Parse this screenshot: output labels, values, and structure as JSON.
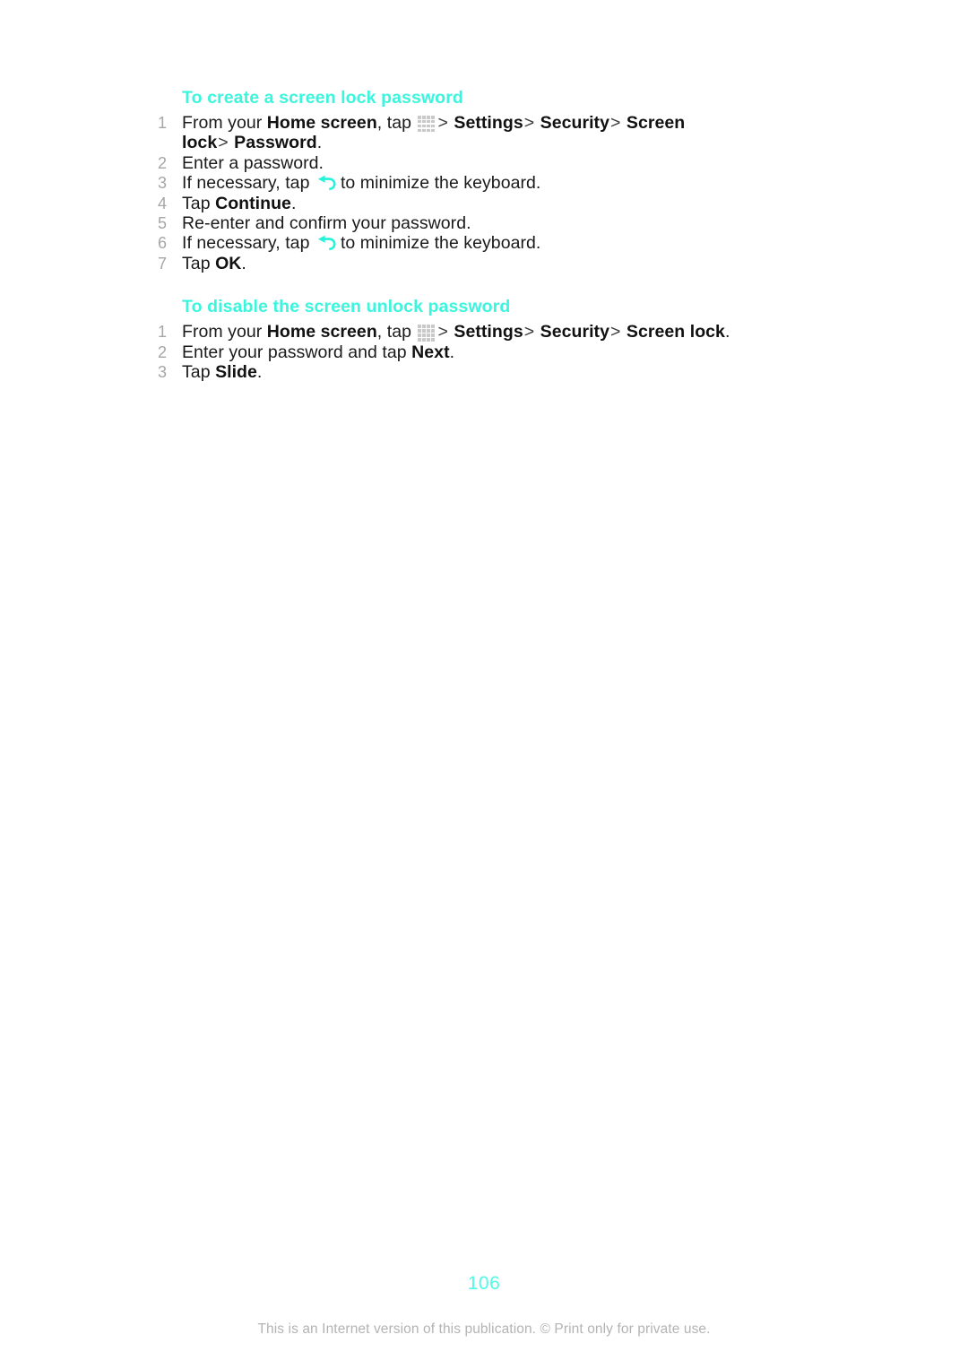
{
  "document": {
    "page_number": "106",
    "footer_note": "This is an Internet version of this publication. © Print only for private use.",
    "accent_color": "#3cf5dd",
    "number_color": "#a6a6a6",
    "text_color": "#1a1a1a",
    "footer_color": "#b3b3b3"
  },
  "sections": [
    {
      "heading": "To create a screen lock password",
      "steps": [
        {
          "number": "1",
          "parts": [
            {
              "type": "text",
              "value": "From your "
            },
            {
              "type": "bold",
              "value": "Home screen"
            },
            {
              "type": "text",
              "value": ", tap "
            },
            {
              "type": "icon",
              "value": "app-grid-icon"
            },
            {
              "type": "sep",
              "value": ">"
            },
            {
              "type": "bold",
              "value": "Settings"
            },
            {
              "type": "sep",
              "value": ">"
            },
            {
              "type": "bold",
              "value": "Security"
            },
            {
              "type": "sep",
              "value": ">"
            },
            {
              "type": "bold",
              "value": "Screen lock"
            },
            {
              "type": "sep",
              "value": ">"
            },
            {
              "type": "bold",
              "value": "Password"
            },
            {
              "type": "text",
              "value": "."
            }
          ]
        },
        {
          "number": "2",
          "parts": [
            {
              "type": "text",
              "value": "Enter a password."
            }
          ]
        },
        {
          "number": "3",
          "parts": [
            {
              "type": "text",
              "value": "If necessary, tap "
            },
            {
              "type": "icon",
              "value": "back-arrow-icon"
            },
            {
              "type": "text",
              "value": "to minimize the keyboard."
            }
          ]
        },
        {
          "number": "4",
          "parts": [
            {
              "type": "text",
              "value": "Tap "
            },
            {
              "type": "bold",
              "value": "Continue"
            },
            {
              "type": "text",
              "value": "."
            }
          ]
        },
        {
          "number": "5",
          "parts": [
            {
              "type": "text",
              "value": "Re-enter and confirm your password."
            }
          ]
        },
        {
          "number": "6",
          "parts": [
            {
              "type": "text",
              "value": "If necessary, tap "
            },
            {
              "type": "icon",
              "value": "back-arrow-icon"
            },
            {
              "type": "text",
              "value": "to minimize the keyboard."
            }
          ]
        },
        {
          "number": "7",
          "parts": [
            {
              "type": "text",
              "value": "Tap "
            },
            {
              "type": "bold",
              "value": "OK"
            },
            {
              "type": "text",
              "value": "."
            }
          ]
        }
      ]
    },
    {
      "heading": "To disable the screen unlock password",
      "steps": [
        {
          "number": "1",
          "parts": [
            {
              "type": "text",
              "value": "From your "
            },
            {
              "type": "bold",
              "value": "Home screen"
            },
            {
              "type": "text",
              "value": ", tap "
            },
            {
              "type": "icon",
              "value": "app-grid-icon"
            },
            {
              "type": "sep",
              "value": ">"
            },
            {
              "type": "bold",
              "value": "Settings"
            },
            {
              "type": "sep",
              "value": ">"
            },
            {
              "type": "bold",
              "value": "Security"
            },
            {
              "type": "sep",
              "value": ">"
            },
            {
              "type": "bold",
              "value": "Screen lock"
            },
            {
              "type": "text",
              "value": "."
            }
          ]
        },
        {
          "number": "2",
          "parts": [
            {
              "type": "text",
              "value": "Enter your password and tap "
            },
            {
              "type": "bold",
              "value": "Next"
            },
            {
              "type": "text",
              "value": "."
            }
          ]
        },
        {
          "number": "3",
          "parts": [
            {
              "type": "text",
              "value": "Tap "
            },
            {
              "type": "bold",
              "value": "Slide"
            },
            {
              "type": "text",
              "value": "."
            }
          ]
        }
      ]
    }
  ]
}
